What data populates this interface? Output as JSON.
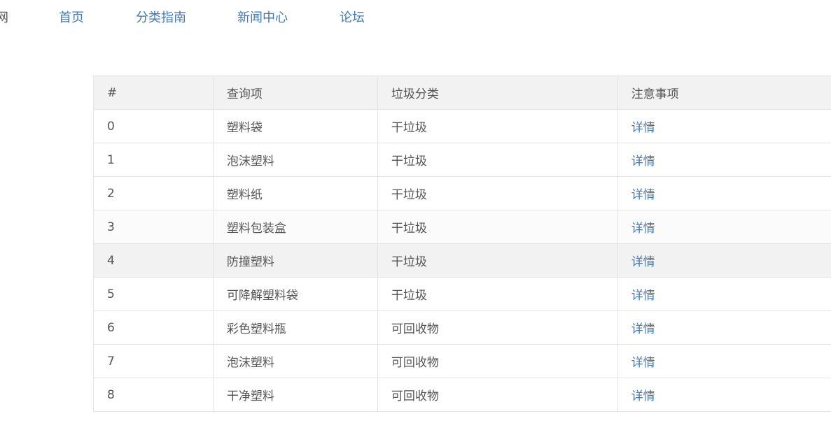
{
  "nav": {
    "brand_fragment": "网",
    "links": [
      "首页",
      "分类指南",
      "新闻中心",
      "论坛"
    ]
  },
  "table": {
    "headers": [
      "#",
      "查询项",
      "垃圾分类",
      "注意事项"
    ],
    "rows": [
      {
        "index": "0",
        "item": "塑料袋",
        "category": "干垃圾",
        "note": "详情"
      },
      {
        "index": "1",
        "item": "泡沫塑料",
        "category": "干垃圾",
        "note": "详情"
      },
      {
        "index": "2",
        "item": "塑料纸",
        "category": "干垃圾",
        "note": "详情"
      },
      {
        "index": "3",
        "item": "塑料包装盒",
        "category": "干垃圾",
        "note": "详情"
      },
      {
        "index": "4",
        "item": "防撞塑料",
        "category": "干垃圾",
        "note": "详情"
      },
      {
        "index": "5",
        "item": "可降解塑料袋",
        "category": "干垃圾",
        "note": "详情"
      },
      {
        "index": "6",
        "item": "彩色塑料瓶",
        "category": "可回收物",
        "note": "详情"
      },
      {
        "index": "7",
        "item": "泡沫塑料",
        "category": "可回收物",
        "note": "详情"
      },
      {
        "index": "8",
        "item": "干净塑料",
        "category": "可回收物",
        "note": "详情"
      }
    ]
  },
  "colors": {
    "link": "#3f7bb5",
    "text": "#555555",
    "header_bg": "#f2f2f2",
    "border": "#e4e4e4"
  }
}
